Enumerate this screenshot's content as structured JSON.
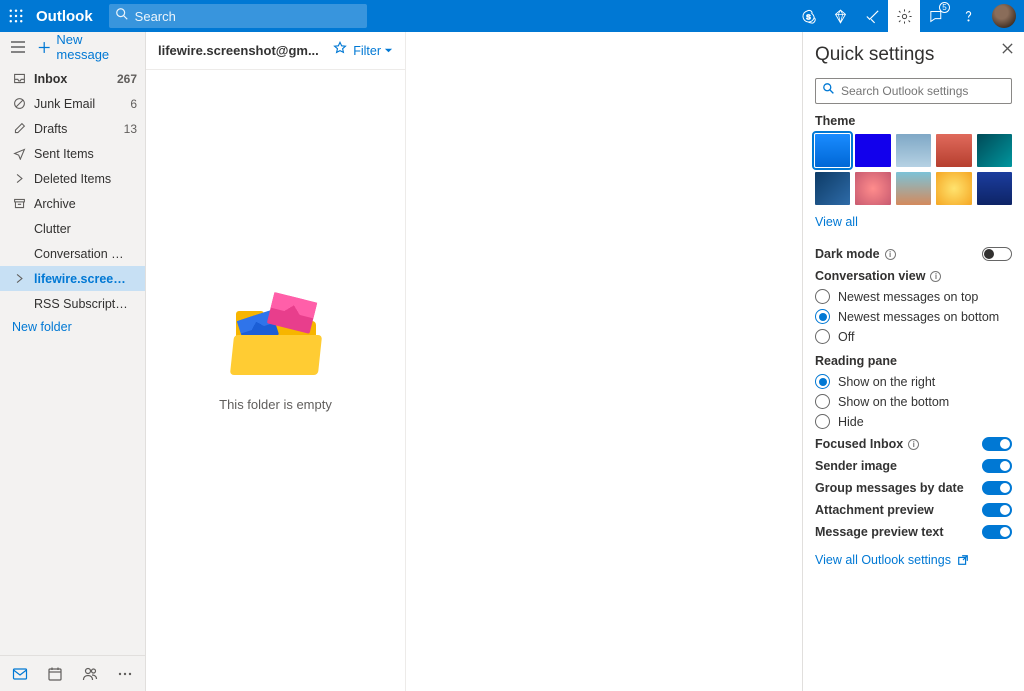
{
  "header": {
    "brand": "Outlook",
    "search_placeholder": "Search",
    "notifications_badge": "5"
  },
  "sidebar": {
    "new_message": "New message",
    "folders": [
      {
        "label": "Inbox",
        "count": "267",
        "icon": "inbox",
        "bold": true
      },
      {
        "label": "Junk Email",
        "count": "6",
        "icon": "junk"
      },
      {
        "label": "Drafts",
        "count": "13",
        "icon": "draft"
      },
      {
        "label": "Sent Items",
        "count": "",
        "icon": "sent"
      },
      {
        "label": "Deleted Items",
        "count": "",
        "icon": "chevron"
      },
      {
        "label": "Archive",
        "count": "",
        "icon": "archive"
      },
      {
        "label": "Clutter",
        "count": "",
        "icon": ""
      },
      {
        "label": "Conversation Hist...",
        "count": "",
        "icon": ""
      },
      {
        "label": "lifewire.screensho...",
        "count": "",
        "icon": "chevron",
        "selected": true
      },
      {
        "label": "RSS Subscriptions",
        "count": "",
        "icon": ""
      },
      {
        "label": "New folder",
        "count": "",
        "icon": "",
        "link": true
      }
    ]
  },
  "list": {
    "title": "lifewire.screenshot@gm...",
    "filter_label": "Filter",
    "empty_text": "This folder is empty"
  },
  "panel": {
    "title": "Quick settings",
    "search_placeholder": "Search Outlook settings",
    "theme_label": "Theme",
    "themes": [
      {
        "bg": "linear-gradient(#1a8cff,#0067d6)",
        "sel": true
      },
      {
        "bg": "#1200ec"
      },
      {
        "bg": "linear-gradient(#7fa8c6,#b5d1e3)"
      },
      {
        "bg": "linear-gradient(#e06a5c,#b63f2f)"
      },
      {
        "bg": "linear-gradient(135deg,#004a57,#00969e)"
      },
      {
        "bg": "linear-gradient(135deg,#0d3b66,#2e6ba8)"
      },
      {
        "bg": "radial-gradient(circle,#ff8c8c,#c75a70)"
      },
      {
        "bg": "linear-gradient(#7cc3d8,#d48a5d)"
      },
      {
        "bg": "radial-gradient(circle,#ffe36e,#f5a623)"
      },
      {
        "bg": "linear-gradient(#1b3d9e,#0e2466)"
      }
    ],
    "view_all": "View all",
    "dark_mode_label": "Dark mode",
    "dark_mode_on": false,
    "conversation_view_label": "Conversation view",
    "conversation_view": {
      "options": [
        "Newest messages on top",
        "Newest messages on bottom",
        "Off"
      ],
      "selected": 1
    },
    "reading_pane_label": "Reading pane",
    "reading_pane": {
      "options": [
        "Show on the right",
        "Show on the bottom",
        "Hide"
      ],
      "selected": 0
    },
    "toggles": [
      {
        "label": "Focused Inbox",
        "info": true,
        "on": true
      },
      {
        "label": "Sender image",
        "info": false,
        "on": true
      },
      {
        "label": "Group messages by date",
        "info": false,
        "on": true
      },
      {
        "label": "Attachment preview",
        "info": false,
        "on": true
      },
      {
        "label": "Message preview text",
        "info": false,
        "on": true
      }
    ],
    "view_all_settings": "View all Outlook settings"
  }
}
